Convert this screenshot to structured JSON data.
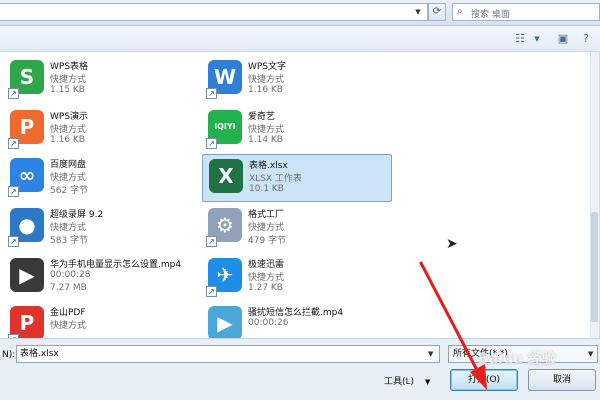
{
  "search": {
    "placeholder": "搜索 桌面"
  },
  "files": [
    {
      "name": "WPS表格",
      "type": "快捷方式",
      "size": "1.15 KB",
      "icon": "S",
      "color": "#2fa64a",
      "shortcut": true
    },
    {
      "name": "WPS文字",
      "type": "快捷方式",
      "size": "1.16 KB",
      "icon": "W",
      "color": "#2f7fd8",
      "shortcut": true
    },
    {
      "name": "WPS演示",
      "type": "快捷方式",
      "size": "1.16 KB",
      "icon": "P",
      "color": "#ef6a2c",
      "shortcut": true
    },
    {
      "name": "爱奇艺",
      "type": "快捷方式",
      "size": "1.14 KB",
      "icon": "iQIYI",
      "color": "#22b14c",
      "shortcut": true
    },
    {
      "name": "百度网盘",
      "type": "快捷方式",
      "size": "562 字节",
      "icon": "∞",
      "color": "#2d82e6",
      "shortcut": true
    },
    {
      "name": "表格.xlsx",
      "type": "XLSX 工作表",
      "size": "10.1 KB",
      "icon": "X",
      "color": "#1f7244",
      "selected": true
    },
    {
      "name": "超级录屏 9.2",
      "type": "快捷方式",
      "size": "583 字节",
      "icon": "●",
      "color": "#2d79c7",
      "shortcut": true
    },
    {
      "name": "格式工厂",
      "type": "快捷方式",
      "size": "479 字节",
      "icon": "⚙",
      "color": "#8fa2b8",
      "shortcut": true
    },
    {
      "name": "华为手机电量显示怎么设置.mp4",
      "type": "00:00:28",
      "size": "7.27 MB",
      "icon": "▶",
      "color": "#3a3a3a"
    },
    {
      "name": "极速迅雷",
      "type": "快捷方式",
      "size": "1.27 KB",
      "icon": "✈",
      "color": "#1e8ee8",
      "shortcut": true
    },
    {
      "name": "金山PDF",
      "type": "快捷方式",
      "size": "",
      "icon": "P",
      "color": "#e0332b",
      "shortcut": true
    },
    {
      "name": "骚扰短信怎么拦截.mp4",
      "type": "00:00:26",
      "size": "",
      "icon": "▶",
      "color": "#4aa8d8"
    }
  ],
  "bottom": {
    "filename_label": "N):",
    "filename_value": "表格.xlsx",
    "filetype_value": "所有文件(*.*)",
    "tools_label": "工具(L)",
    "open_label": "打开(O)",
    "cancel_label": "取消"
  },
  "watermark": "Baidu 经验"
}
